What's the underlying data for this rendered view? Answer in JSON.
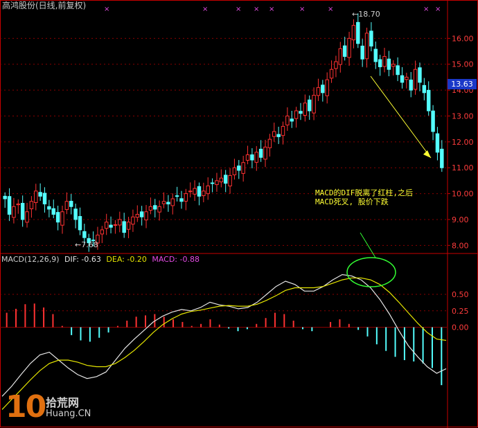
{
  "window": {
    "title": "高鸿股份(日线,前复权)"
  },
  "colors": {
    "up": "#ff3232",
    "down": "#54ffff",
    "grid": "#8b0000",
    "frame": "#c80000",
    "dif": "#e6e6e6",
    "dea": "#e6e600",
    "macd_label": "#e64ce6",
    "annotation": "#ffff33"
  },
  "price_tag": "13.63",
  "macd_header": {
    "name": "MACD(12,26,9)",
    "dif": "DIF: -0.63",
    "dea": "DEA: -0.20",
    "macd": "MACD: -0.88"
  },
  "annotation": {
    "text": "MACD的DIF脱离了红柱,之后MACD死叉, 股价下跌"
  },
  "watermark": {
    "number": "10",
    "name": "拾荒网",
    "site": "Huang.CN"
  },
  "chart_data": [
    {
      "type": "candlestick",
      "title": "高鸿股份(日线,前复权)",
      "ylim": [
        7.5,
        17.0
      ],
      "yticks": [
        8.0,
        9.0,
        10.0,
        11.0,
        12.0,
        13.0,
        14.0,
        15.0,
        16.0
      ],
      "annotations": [
        "18.70",
        "7.68",
        "13.63"
      ],
      "close_trend": [
        9.8,
        9.2,
        9.5,
        9.6,
        9.0,
        9.3,
        9.7,
        10.1,
        9.9,
        9.6,
        9.4,
        9.2,
        8.9,
        9.3,
        9.7,
        9.5,
        9.0,
        8.6,
        8.3,
        8.1,
        8.2,
        8.4,
        8.6,
        8.9,
        8.7,
        8.8,
        9.0,
        8.5,
        8.9,
        9.1,
        9.2,
        9.1,
        9.3,
        9.5,
        9.4,
        9.5,
        9.7,
        9.6,
        9.8,
        9.9,
        9.7,
        10.0,
        10.1,
        10.2,
        9.9,
        10.1,
        10.3,
        10.4,
        10.5,
        10.6,
        10.4,
        10.7,
        11.0,
        10.9,
        11.2,
        11.5,
        11.3,
        11.6,
        11.4,
        11.8,
        12.1,
        12.4,
        12.2,
        12.6,
        13.0,
        12.8,
        13.2,
        13.1,
        13.5,
        13.2,
        13.8,
        14.1,
        13.9,
        14.4,
        14.8,
        15.1,
        15.6,
        15.3,
        16.0,
        16.5,
        15.8,
        15.2,
        16.2,
        15.7,
        15.1,
        14.9,
        15.3,
        14.8,
        15.0,
        14.6,
        14.3,
        14.5,
        14.0,
        14.8,
        14.3,
        13.9,
        13.2,
        12.4,
        11.6,
        11.0
      ]
    },
    {
      "type": "macd",
      "title": "MACD(12,26,9)",
      "ylim": [
        -1.5,
        1.1
      ],
      "yticks": [
        0.0,
        0.25,
        0.5
      ],
      "series": [
        {
          "name": "DIF",
          "values": [
            -1.05,
            -0.9,
            -0.72,
            -0.55,
            -0.42,
            -0.38,
            -0.5,
            -0.62,
            -0.72,
            -0.78,
            -0.75,
            -0.68,
            -0.5,
            -0.32,
            -0.18,
            -0.05,
            0.08,
            0.17,
            0.23,
            0.27,
            0.25,
            0.3,
            0.38,
            0.34,
            0.32,
            0.28,
            0.3,
            0.38,
            0.5,
            0.62,
            0.7,
            0.65,
            0.55,
            0.55,
            0.62,
            0.72,
            0.8,
            0.78,
            0.72,
            0.6,
            0.42,
            0.2,
            -0.05,
            -0.28,
            -0.45,
            -0.6,
            -0.7,
            -0.63
          ]
        },
        {
          "name": "DEA",
          "values": [
            -1.25,
            -1.1,
            -0.95,
            -0.8,
            -0.66,
            -0.55,
            -0.5,
            -0.5,
            -0.53,
            -0.58,
            -0.6,
            -0.6,
            -0.55,
            -0.46,
            -0.35,
            -0.22,
            -0.08,
            0.04,
            0.13,
            0.2,
            0.24,
            0.26,
            0.29,
            0.32,
            0.33,
            0.32,
            0.32,
            0.35,
            0.41,
            0.48,
            0.56,
            0.6,
            0.6,
            0.6,
            0.62,
            0.67,
            0.72,
            0.75,
            0.75,
            0.72,
            0.65,
            0.53,
            0.38,
            0.22,
            0.06,
            -0.08,
            -0.18,
            -0.2
          ]
        }
      ],
      "histogram": [
        0.22,
        0.28,
        0.35,
        0.36,
        0.3,
        0.2,
        0.02,
        -0.12,
        -0.2,
        -0.22,
        -0.16,
        -0.08,
        0.02,
        0.1,
        0.16,
        0.18,
        0.2,
        0.16,
        0.12,
        0.08,
        0.02,
        0.05,
        0.12,
        0.04,
        -0.02,
        -0.06,
        -0.03,
        0.05,
        0.14,
        0.22,
        0.2,
        0.1,
        -0.03,
        -0.06,
        0.0,
        0.08,
        0.12,
        0.05,
        -0.04,
        -0.14,
        -0.26,
        -0.36,
        -0.45,
        -0.5,
        -0.52,
        -0.55,
        -0.62,
        -0.88
      ]
    }
  ]
}
